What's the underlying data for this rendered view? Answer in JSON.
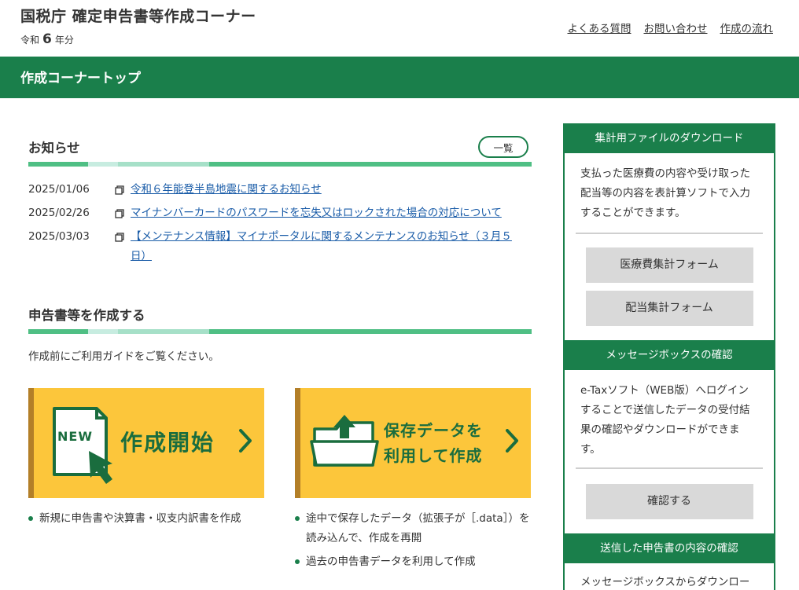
{
  "header": {
    "title": "国税庁 確定申告書等作成コーナー",
    "year_prefix": "令和",
    "year_num": "6",
    "year_suffix": "年分",
    "links": [
      "よくある質問",
      "お問い合わせ",
      "作成の流れ"
    ]
  },
  "nav": {
    "title": "作成コーナートップ"
  },
  "news": {
    "heading": "お知らせ",
    "list_button": "一覧",
    "items": [
      {
        "date": "2025/01/06",
        "text": "令和６年能登半島地震に関するお知らせ"
      },
      {
        "date": "2025/02/26",
        "text": "マイナンバーカードのパスワードを忘失又はロックされた場合の対応について"
      },
      {
        "date": "2025/03/03",
        "text": "【メンテナンス情報】マイナポータルに関するメンテナンスのお知らせ（３月５日）"
      }
    ]
  },
  "create": {
    "heading": "申告書等を作成する",
    "guide": "作成前にご利用ガイドをご覧ください。",
    "card_new": {
      "label": "作成開始",
      "badge": "NEW"
    },
    "card_saved": {
      "label_line1": "保存データを",
      "label_line2": "利用して作成"
    },
    "bullets_new": [
      "新規に申告書や決算書・収支内訳書を作成"
    ],
    "bullets_saved": [
      "途中で保存したデータ（拡張子が［.data］）を読み込んで、作成を再開",
      "過去の申告書データを利用して作成"
    ]
  },
  "sidebar": {
    "download": {
      "heading": "集計用ファイルのダウンロード",
      "text": "支払った医療費の内容や受け取った配当等の内容を表計算ソフトで入力することができます。",
      "buttons": [
        "医療費集計フォーム",
        "配当集計フォーム"
      ]
    },
    "message": {
      "heading": "メッセージボックスの確認",
      "text": "e-Taxソフト（WEB版）へログインすることで送信したデータの受付結果の確認やダウンロードができます。",
      "button": "確認する"
    },
    "sent": {
      "heading": "送信した申告書の内容の確認",
      "text": "メッセージボックスからダウンロー"
    }
  },
  "colors": {
    "brand_green": "#1a7f4b",
    "card_yellow": "#fcc63b",
    "link_blue": "#1a5ca8"
  }
}
